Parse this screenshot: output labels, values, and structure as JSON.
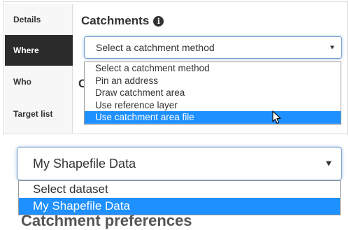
{
  "sidebar": {
    "items": [
      {
        "label": "Details",
        "active": false
      },
      {
        "label": "Where",
        "active": true
      },
      {
        "label": "Who",
        "active": false
      },
      {
        "label": "Target list",
        "active": false
      }
    ]
  },
  "main": {
    "heading": "Catchments",
    "info_icon": "i",
    "hidden_letter": "C",
    "method_select": {
      "selected": "Select a catchment method",
      "options": [
        "Select a catchment method",
        "Pin an address",
        "Draw catchment area",
        "Use reference layer",
        "Use catchment area file"
      ],
      "highlighted_index": 4
    }
  },
  "zoom": {
    "dataset_select": {
      "selected": "My Shapefile Data",
      "options": [
        "Select dataset",
        "My Shapefile Data"
      ],
      "highlighted_index": 1
    },
    "behind_heading": "Catchment preferences"
  },
  "colors": {
    "highlight": "#1e90ff",
    "active_tab": "#2b2b2b",
    "focus_border": "#6d9bd1"
  }
}
